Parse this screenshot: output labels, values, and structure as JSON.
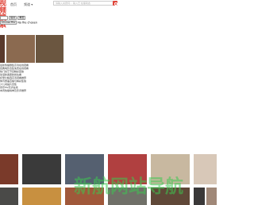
{
  "header": {
    "logo_text": "视频搜索",
    "nav": [
      {
        "label": "首页"
      },
      {
        "label": "频道 ▾"
      }
    ],
    "search": {
      "placeholder": "请输入关键词…   输入已   在播动态"
    }
  },
  "upload_form": {
    "input_value": "",
    "submit_label": "提交",
    "reset_label": "重置",
    "file_button_label": "Choose File",
    "file_status": "No file chosen"
  },
  "featured_thumbs": [
    {
      "name": "thumb-1",
      "color": "#5a3a2c"
    },
    {
      "name": "thumb-2",
      "color": "#8b6a50"
    },
    {
      "name": "thumb-3",
      "color": "#6b5640"
    }
  ],
  "list_items": [
    "最新热播剧集高清在线观看",
    "经典电影合集免费在线观看",
    "热门综艺节目精彩回放",
    "动漫新番更新抢先看",
    "纪录片精选高清观看推荐",
    "体育赛事直播与精彩集锦",
    "少儿动画片合集",
    "音乐MV高清在线",
    "本周热播榜单及影评推荐"
  ],
  "bottom_thumbs_row1": [
    {
      "color": "#7a3a2a"
    },
    {
      "color": "#3a3a3a"
    },
    {
      "color": "#556070"
    },
    {
      "color": "#b04040"
    },
    {
      "color": "#c8b8a0"
    },
    {
      "color": "#d8c8b8"
    }
  ],
  "bottom_thumbs_row2": [
    {
      "color": "#4a4a48"
    },
    {
      "color": "#c89040"
    },
    {
      "color": "#a0583a"
    },
    {
      "color": "#707068"
    },
    {
      "color": "#604838"
    },
    {
      "color": "#3a3838"
    },
    {
      "color": "#a08878"
    }
  ],
  "watermark_text": "新航网站导航"
}
